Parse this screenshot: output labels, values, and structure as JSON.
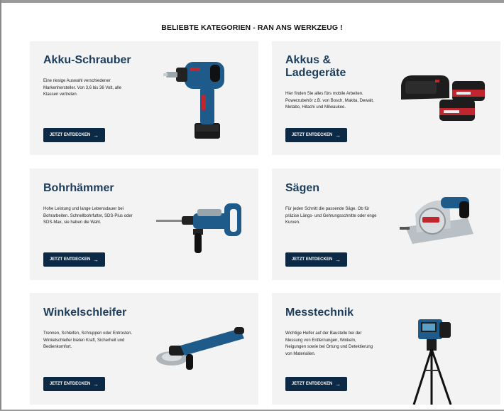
{
  "section": {
    "heading": "BELIEBTE KATEGORIEN - RAN ANS WERKZEUG !"
  },
  "cta_arrow": "→",
  "categories": [
    {
      "title": "Akku-Schrauber",
      "description": "Eine riesige Auswahl verschiedener Markenhersteller. Von 3,6 bis 36 Volt, alle Klassen vertreten.",
      "cta": "JETZT ENTDECKEN",
      "image_icon": "cordless-drill-icon"
    },
    {
      "title": "Akkus & Ladegeräte",
      "description": "Hier finden Sie alles fürs mobile Arbeiten. Powerzubehör z.B. von Bosch, Makita, Dewalt, Metabo, Hitachi und Milwaukee.",
      "cta": "JETZT ENTDECKEN",
      "image_icon": "battery-charger-icon"
    },
    {
      "title": "Bohrhämmer",
      "description": "Hohe Leistung und lange Lebensdauer bei Bohrarbeiten. Schnellbohrfutter, SDS-Plus oder SDS-Max, sie haben die Wahl.",
      "cta": "JETZT ENTDECKEN",
      "image_icon": "rotary-hammer-icon"
    },
    {
      "title": "Sägen",
      "description": "Für jeden Schnitt die passende Säge. Ob für präzise Längs- und Gehrungsschnitte oder enge Kurven.",
      "cta": "JETZT ENTDECKEN",
      "image_icon": "circular-saw-icon"
    },
    {
      "title": "Winkelschleifer",
      "description": "Trennen, Schleifen, Schruppen oder Entrosten. Winkelschleifer bieten Kraft, Sicherheit und Bedienkomfort.",
      "cta": "JETZT ENTDECKEN",
      "image_icon": "angle-grinder-icon"
    },
    {
      "title": "Messtechnik",
      "description": "Wichtige Helfer auf der Baustelle bei der Messung von Entfernungen, Winkeln, Neigungen sowie bei Ortung und Detektierung von Materialien.",
      "cta": "JETZT ENTDECKEN",
      "image_icon": "laser-measure-tripod-icon"
    }
  ],
  "colors": {
    "card_background": "#f3f3f3",
    "title": "#1c3d5c",
    "button": "#0c2a45",
    "tool_blue": "#1e5b8a"
  }
}
